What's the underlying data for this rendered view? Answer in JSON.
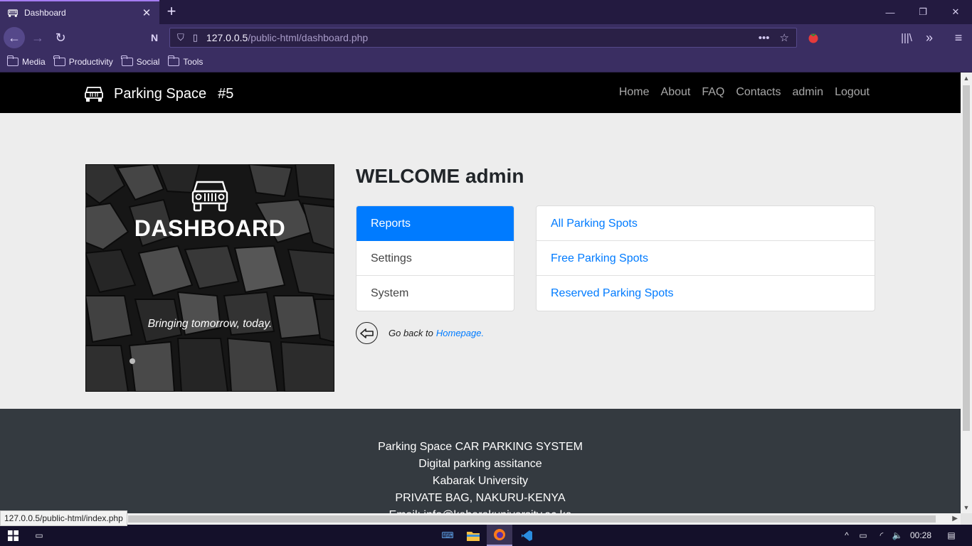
{
  "browser": {
    "tab_title": "Dashboard",
    "url_host": "127.0.0.5",
    "url_path": "/public-html/dashboard.php",
    "bookmarks": [
      "Media",
      "Productivity",
      "Social",
      "Tools"
    ],
    "status_link": "127.0.0.5/public-html/index.php"
  },
  "site": {
    "brand": "Parking Space",
    "brand_number": "#5",
    "nav": [
      "Home",
      "About",
      "FAQ",
      "Contacts",
      "admin",
      "Logout"
    ]
  },
  "hero": {
    "title": "DASHBOARD",
    "tagline": "Bringing tomorrow, today."
  },
  "welcome": "WELCOME admin",
  "menu_left": [
    {
      "label": "Reports",
      "active": true
    },
    {
      "label": "Settings",
      "active": false
    },
    {
      "label": "System",
      "active": false
    }
  ],
  "menu_right": [
    "All Parking Spots",
    "Free Parking Spots",
    "Reserved Parking Spots"
  ],
  "goback": {
    "text": "Go back to",
    "link": "Homepage."
  },
  "footer": [
    "Parking Space CAR PARKING SYSTEM",
    "Digital parking assitance",
    "Kabarak University",
    "PRIVATE BAG, NAKURU-KENYA",
    "Email: info@kabarakuniversity.ac.ke"
  ],
  "taskbar": {
    "clock": "00:28"
  },
  "colors": {
    "primary": "#007bff",
    "browser_chrome": "#3a2e62",
    "site_nav": "#000000",
    "footer": "#343a40"
  }
}
